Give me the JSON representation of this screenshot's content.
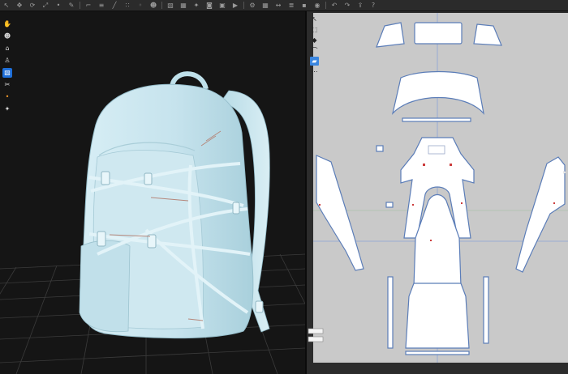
{
  "toolbar": {
    "icons": [
      "select-icon",
      "move-icon",
      "rotate-icon",
      "scale-icon",
      "pin-icon",
      "brush-icon",
      "fold-icon",
      "seam-icon",
      "needle-icon",
      "zip-icon",
      "button-icon",
      "avatar-icon",
      "fabric-icon",
      "texture-icon",
      "light-icon",
      "camera-icon",
      "render-icon",
      "sim-icon",
      "gear-icon",
      "grid-icon",
      "measure-icon",
      "layer-icon",
      "lock-icon",
      "eye-icon",
      "undo-icon",
      "redo-icon",
      "export-icon",
      "help-icon"
    ]
  },
  "viewport3d": {
    "tools": [
      {
        "icon": "hand-icon",
        "style": "plain"
      },
      {
        "icon": "avatar-icon",
        "style": "plain"
      },
      {
        "icon": "hanger-icon",
        "style": "plain"
      },
      {
        "icon": "figure-icon",
        "style": "plain"
      },
      {
        "icon": "fabric-icon",
        "style": "blue"
      },
      {
        "icon": "sew-icon",
        "style": "plain"
      },
      {
        "icon": "pin-icon",
        "style": "orange"
      },
      {
        "icon": "light-icon",
        "style": "plain"
      }
    ],
    "object": "backpack-3d-model",
    "colors": {
      "background": "#151515",
      "grid": "#3a3a3a",
      "fabric": "#cbe6ef",
      "fabric_shadow": "#9fc6d3",
      "stitch": "#b5867a"
    }
  },
  "pattern2d": {
    "tools": [
      {
        "icon": "select-pointer-icon",
        "style": "plain"
      },
      {
        "icon": "transform-icon",
        "style": "plain"
      },
      {
        "icon": "edit-point-icon",
        "style": "plain"
      },
      {
        "icon": "segment-icon",
        "style": "plain"
      },
      {
        "icon": "pattern-tool-icon",
        "style": "blue"
      },
      {
        "icon": "sewing-tool-icon",
        "style": "plain"
      }
    ],
    "colors": {
      "background": "#c9c9c9",
      "piece": "#ffffff",
      "outline": "#5b7db8",
      "axis_blue": "#8da3d6",
      "axis_green": "#9fbf9f",
      "seam_red": "#cc3b3b"
    }
  }
}
